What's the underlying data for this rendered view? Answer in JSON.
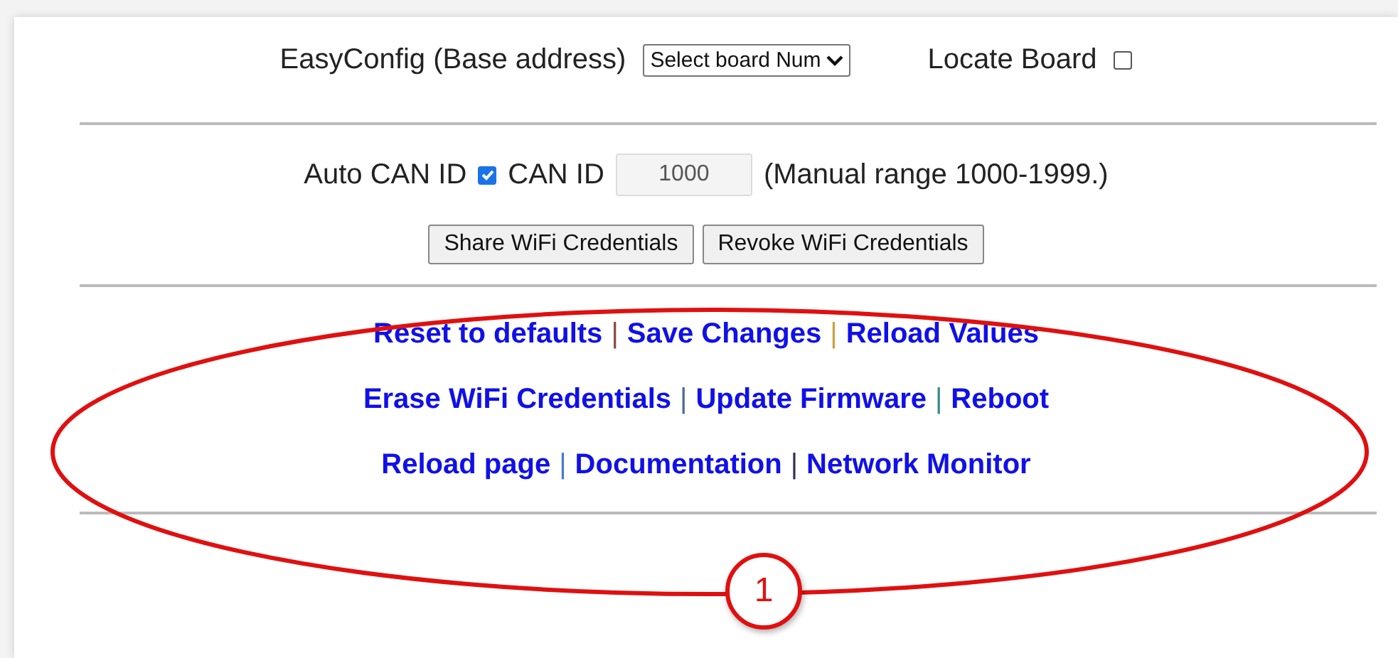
{
  "easyconfig": {
    "label": "EasyConfig (Base address)",
    "select": "Select board Num",
    "locate_label": "Locate Board",
    "locate_checked": false
  },
  "can": {
    "auto_label": "Auto CAN ID",
    "auto_checked": true,
    "id_label": "CAN ID",
    "id_value": "1000",
    "range_note": "(Manual range 1000-1999.)"
  },
  "buttons": [
    "Share WiFi Credentials",
    "Revoke WiFi Credentials"
  ],
  "link_rows": [
    {
      "items": [
        {
          "kind": "link",
          "text": "Reset to defaults"
        },
        {
          "kind": "sep",
          "text": "|",
          "color": "#8b4a3a"
        },
        {
          "kind": "link",
          "text": "Save Changes"
        },
        {
          "kind": "sep",
          "text": "|",
          "color": "#c8a040"
        },
        {
          "kind": "link",
          "text": "Reload Values"
        }
      ]
    },
    {
      "items": [
        {
          "kind": "link",
          "text": "Erase WiFi Credentials"
        },
        {
          "kind": "sep",
          "text": "|",
          "color": "#4a6a9a"
        },
        {
          "kind": "link",
          "text": "Update Firmware"
        },
        {
          "kind": "sep",
          "text": "|",
          "color": "#3a8a8a"
        },
        {
          "kind": "link",
          "text": "Reboot"
        }
      ]
    },
    {
      "items": [
        {
          "kind": "link",
          "text": "Reload page"
        },
        {
          "kind": "sep",
          "text": "|",
          "color": "#4a7ad0"
        },
        {
          "kind": "link",
          "text": "Documentation"
        },
        {
          "kind": "sep",
          "text": "|",
          "color": "#333355"
        },
        {
          "kind": "link",
          "text": "Network Monitor"
        }
      ]
    }
  ],
  "callout": {
    "number": "1"
  }
}
